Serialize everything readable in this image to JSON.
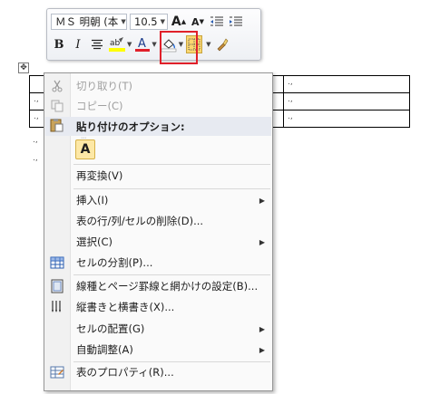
{
  "toolbar": {
    "font_name": "ＭＳ 明朝 (本",
    "font_size": "10.5",
    "grow_font_glyph": "A",
    "shrink_font_glyph": "A",
    "bold_glyph": "B",
    "italic_glyph": "I",
    "highlight_glyph": "ab",
    "font_color_glyph": "A"
  },
  "table": {
    "rows": [
      [
        "",
        ".,",
        ".,"
      ],
      [
        ".,",
        ".,",
        ".,"
      ],
      [
        ".,",
        ".,",
        ".,"
      ]
    ],
    "paragraph_marks": [
      ".,",
      ".,"
    ]
  },
  "context_menu": {
    "cut": "切り取り(T)",
    "copy": "コピー(C)",
    "paste_options": "貼り付けのオプション:",
    "paste_keep_text": "A",
    "reconvert": "再変換(V)",
    "insert": "挿入(I)",
    "delete_cells": "表の行/列/セルの削除(D)...",
    "select": "選択(C)",
    "split_cells": "セルの分割(P)...",
    "borders_shading": "線種とページ罫線と網かけの設定(B)...",
    "text_direction": "縦書きと横書き(X)...",
    "cell_alignment": "セルの配置(G)",
    "autofit": "自動調整(A)",
    "table_properties": "表のプロパティ(R)...",
    "submenu_arrow": "▶"
  },
  "colors": {
    "highlight_yellow": "#ffff00",
    "font_color_red": "#e0202a",
    "highlight_box": "#e0202a"
  }
}
